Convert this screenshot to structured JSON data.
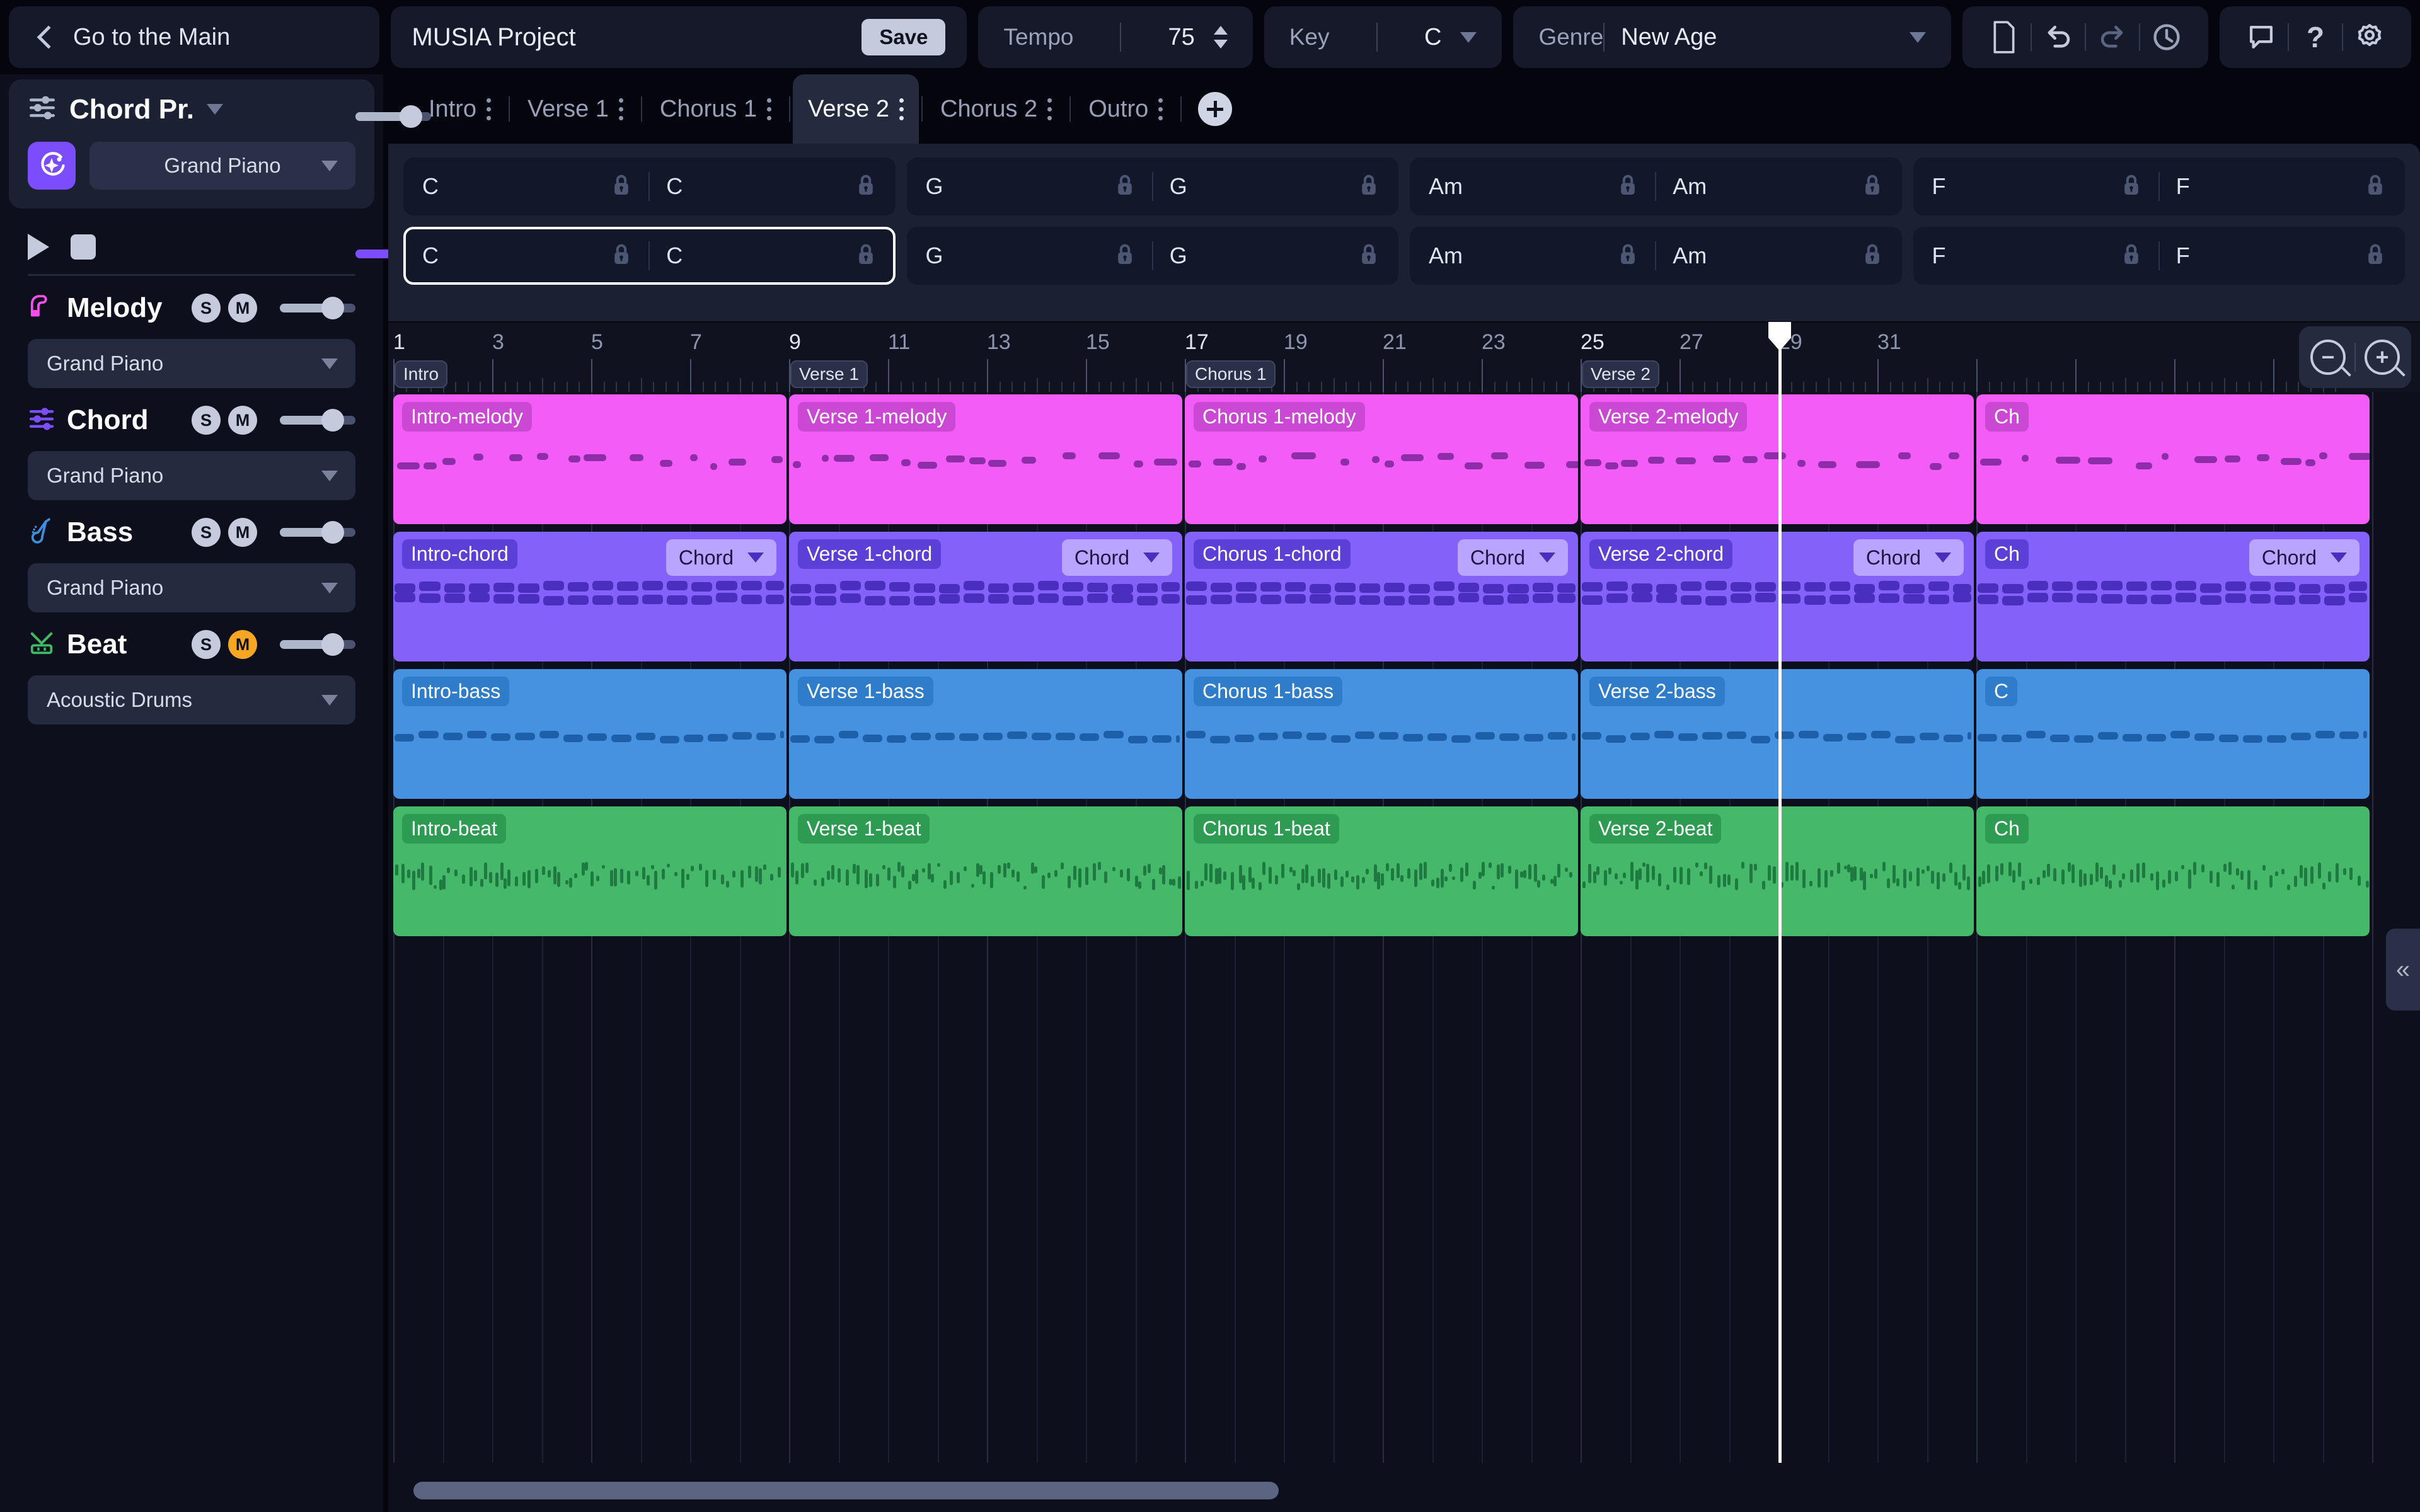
{
  "topbar": {
    "back_label": "Go to the Main",
    "project_title": "MUSIA Project",
    "save_label": "Save",
    "tempo_label": "Tempo",
    "tempo_value": "75",
    "key_label": "Key",
    "key_value": "C",
    "genre_label": "Genre",
    "genre_value": "New Age",
    "icons": [
      "file-icon",
      "undo-icon",
      "redo-icon",
      "history-icon",
      "feedback-icon",
      "help-icon",
      "settings-icon"
    ]
  },
  "tabs": {
    "items": [
      {
        "label": "Intro",
        "active": false
      },
      {
        "label": "Verse 1",
        "active": false
      },
      {
        "label": "Chorus 1",
        "active": false
      },
      {
        "label": "Verse 2",
        "active": true
      },
      {
        "label": "Chorus 2",
        "active": false
      },
      {
        "label": "Outro",
        "active": false
      }
    ],
    "add_label": "+"
  },
  "chord_progression": {
    "panel_title": "Chord Pr.",
    "instrument": "Grand Piano",
    "volume": 88,
    "rows": [
      {
        "selected_index": -1,
        "groups": [
          [
            "C",
            "C"
          ],
          [
            "G",
            "G"
          ],
          [
            "Am",
            "Am"
          ],
          [
            "F",
            "F"
          ]
        ]
      },
      {
        "selected_index": 0,
        "groups": [
          [
            "C",
            "C"
          ],
          [
            "G",
            "G"
          ],
          [
            "Am",
            "Am"
          ],
          [
            "F",
            "F"
          ]
        ]
      }
    ]
  },
  "transport": {
    "play_label": "play-icon",
    "stop_label": "stop-icon",
    "master_volume": 55
  },
  "tracks": [
    {
      "name": "Melody",
      "icon": "piano-icon",
      "color": "#ff4df0",
      "instrument": "Grand Piano",
      "solo": "S",
      "mute": "M",
      "muted": false,
      "volume": 70
    },
    {
      "name": "Chord",
      "icon": "sliders-icon",
      "color": "#7c4dff",
      "instrument": "Grand Piano",
      "solo": "S",
      "mute": "M",
      "muted": false,
      "volume": 70
    },
    {
      "name": "Bass",
      "icon": "bass-guitar-icon",
      "color": "#3f8fe0",
      "instrument": "Grand Piano",
      "solo": "S",
      "mute": "M",
      "muted": false,
      "volume": 70
    },
    {
      "name": "Beat",
      "icon": "drum-icon",
      "color": "#3fb963",
      "instrument": "Acoustic Drums",
      "solo": "S",
      "mute": "M",
      "muted": true,
      "volume": 70
    }
  ],
  "timeline": {
    "bar_numbers": [
      "1",
      "3",
      "5",
      "7",
      "9",
      "11",
      "13",
      "15",
      "17",
      "19",
      "21",
      "23",
      "25",
      "27",
      "29",
      "31"
    ],
    "major_bars": [
      "1",
      "9",
      "17",
      "25"
    ],
    "section_markers": [
      {
        "label": "Intro",
        "bar": 1
      },
      {
        "label": "Verse 1",
        "bar": 9
      },
      {
        "label": "Chorus 1",
        "bar": 17
      },
      {
        "label": "Verse 2",
        "bar": 25
      }
    ],
    "playhead_bar": 29,
    "zoom_out_label": "zoom-out-icon",
    "zoom_in_label": "zoom-in-icon",
    "collapse_label": "«",
    "clips": {
      "melody": [
        "Intro-melody",
        "Verse 1-melody",
        "Chorus 1-melody",
        "Verse 2-melody",
        "Ch"
      ],
      "chord": [
        "Intro-chord",
        "Verse 1-chord",
        "Chorus 1-chord",
        "Verse 2-chord",
        "Ch"
      ],
      "bass": [
        "Intro-bass",
        "Verse 1-bass",
        "Chorus 1-bass",
        "Verse 2-bass",
        "C"
      ],
      "beat": [
        "Intro-beat",
        "Verse 1-beat",
        "Chorus 1-beat",
        "Verse 2-beat",
        "Ch"
      ]
    },
    "chord_mode_label": "Chord"
  }
}
